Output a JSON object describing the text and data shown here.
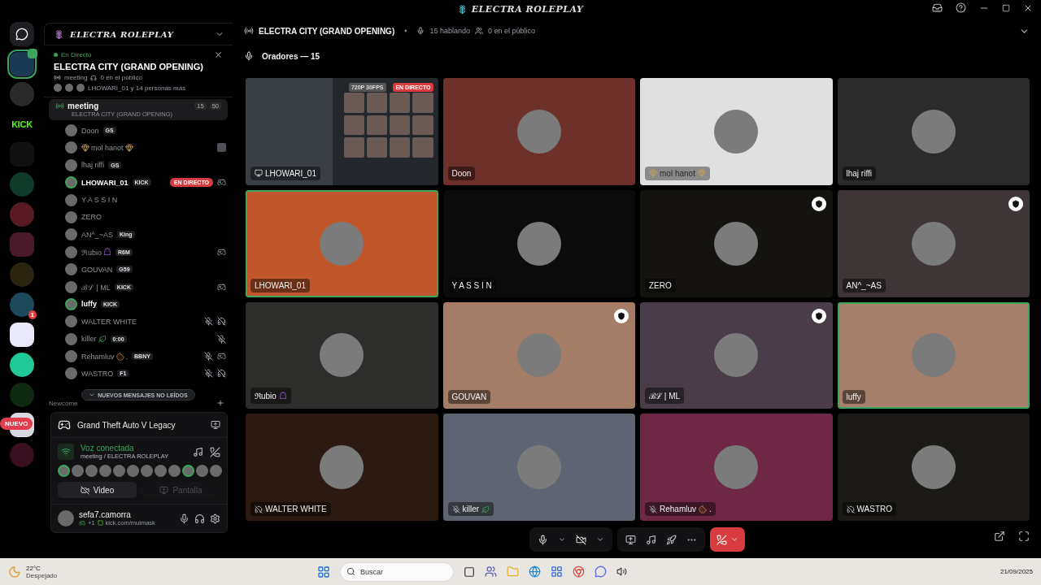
{
  "window": {
    "title": "ELECTRA ROLEPLAY"
  },
  "server_rail": [
    {
      "kind": "home"
    },
    {
      "kind": "server",
      "color": "#1b3a55",
      "unread": true
    },
    {
      "kind": "server",
      "color": "#2a2a2a",
      "unread": false
    },
    {
      "kind": "logo",
      "label": "KICK"
    },
    {
      "kind": "server",
      "color": "#111111",
      "unread": false
    },
    {
      "kind": "server",
      "color": "#0e3b2a",
      "unread": false
    },
    {
      "kind": "server",
      "color": "#5a1a24",
      "unread": false
    },
    {
      "kind": "server",
      "color": "#4a1a2a",
      "unread": false
    },
    {
      "kind": "server",
      "color": "#2b2410",
      "unread": false
    },
    {
      "kind": "server",
      "color": "#1d4a5a",
      "unread": false,
      "badge": "1"
    },
    {
      "kind": "server",
      "color": "#e8e8f8",
      "unread": false
    },
    {
      "kind": "server",
      "color": "#20c997",
      "unread": false
    },
    {
      "kind": "server",
      "color": "#102a12",
      "unread": false
    },
    {
      "kind": "server",
      "color": "#d8d8e0",
      "unread": false,
      "pill": "NUEVO"
    },
    {
      "kind": "server",
      "color": "#3a1020",
      "unread": false
    }
  ],
  "sidebar": {
    "server_name": "ELECTRA ROLEPLAY",
    "live_card": {
      "status": "En Directo",
      "title": "ELECTRA CITY (GRAND OPENING)",
      "channel": "meeting",
      "audience": "0 en el público",
      "participants": "LHOWARI_01 y 14 personas más"
    },
    "channel": {
      "name": "meeting",
      "topic": "ELECTRA CITY (GRAND OPENING)",
      "count": "15",
      "limit": "50"
    },
    "members": [
      {
        "name": "Doon",
        "tag": "GS",
        "speaking": false,
        "live": false
      },
      {
        "name": "mol hanot",
        "emoji": {
          "kind": "trident"
        },
        "speaking": false,
        "live": false,
        "icons": [
          {
            "kind": "app"
          }
        ]
      },
      {
        "name": "lhaj riffi",
        "tag": "GS",
        "speaking": false,
        "live": false
      },
      {
        "name": "LHOWARI_01",
        "tag": "KICK",
        "speaking": true,
        "live": true,
        "live_label": "EN DIRECTO",
        "icons": [
          {
            "kind": "game"
          }
        ]
      },
      {
        "name": "Y A S S I N",
        "speaking": false,
        "live": false
      },
      {
        "name": "ZERO",
        "speaking": false,
        "live": false
      },
      {
        "name": "AN^_~AS",
        "tag": "King",
        "speaking": false,
        "live": false
      },
      {
        "name": "ℜubio",
        "emoji": {
          "kind": "alien"
        },
        "tag": "R6M",
        "speaking": false,
        "live": false,
        "icons": [
          {
            "kind": "game"
          }
        ]
      },
      {
        "name": "GOUVAN",
        "tag": "G59",
        "speaking": false,
        "live": false
      },
      {
        "name": "ℬℒ | ML",
        "tag": "KICK",
        "speaking": false,
        "live": false,
        "icons": [
          {
            "kind": "game"
          }
        ]
      },
      {
        "name": "luffy",
        "tag": "KICK",
        "speaking": true,
        "live": false
      },
      {
        "name": "WALTER WHITE",
        "speaking": false,
        "live": false,
        "icons": [
          {
            "kind": "muted"
          },
          {
            "kind": "deafened"
          }
        ]
      },
      {
        "name": "killer",
        "emoji": {
          "kind": "leaf"
        },
        "tag": "0:00",
        "speaking": false,
        "live": false,
        "icons": [
          {
            "kind": "muted"
          }
        ]
      },
      {
        "name": "Rehamluv",
        "emoji": {
          "kind": "cookie"
        },
        "name_end": ".",
        "tag": "BBNY",
        "speaking": false,
        "live": false,
        "icons": [
          {
            "kind": "muted"
          },
          {
            "kind": "game"
          }
        ]
      },
      {
        "name": "WASTRO",
        "tag": "F1",
        "speaking": false,
        "live": false,
        "icons": [
          {
            "kind": "muted"
          },
          {
            "kind": "deafened"
          }
        ]
      }
    ],
    "unread_pill": "NUEVOS MENSAJES NO LEÍDOS",
    "next_category": "Newcome",
    "activity": {
      "game": "Grand Theft Auto V Legacy"
    },
    "voice": {
      "status": "Voz conectada",
      "location": "meeting / ELECTRA ROLEPLAY",
      "avatars": [
        {
          "speaking": true
        },
        {
          "speaking": false
        },
        {
          "speaking": false
        },
        {
          "speaking": false
        },
        {
          "speaking": false
        },
        {
          "speaking": false
        },
        {
          "speaking": false
        },
        {
          "speaking": false
        },
        {
          "speaking": false
        },
        {
          "speaking": true
        },
        {
          "speaking": false
        },
        {
          "speaking": false
        }
      ],
      "buttons": [
        {
          "label": "Video",
          "disabled": false
        },
        {
          "label": "Pantalla",
          "disabled": true
        }
      ]
    },
    "user": {
      "name": "sefa7.camorra",
      "activity_count": "+1",
      "status": "kick.com/mulmask"
    }
  },
  "stage": {
    "title": "ELECTRA CITY (GRAND OPENING)",
    "separator": "•",
    "speaking": "15 hablando",
    "audience": "0 en el público",
    "speakers_label": "Oradores — 15",
    "tiles": [
      {
        "kind": "stream",
        "name": "LHOWARI_01",
        "color": "#2a2d33",
        "speaking": false,
        "badge": false,
        "status": {
          "kind": "screen"
        },
        "quality": "720P 30FPS",
        "live_label": "EN DIRECTO"
      },
      {
        "kind": "user",
        "name": "Doon",
        "color": "#6e302a",
        "speaking": false,
        "badge": false
      },
      {
        "kind": "user",
        "name": "mol hanot",
        "emoji": {
          "kind": "trident"
        },
        "color": "#e0e0e0",
        "speaking": false,
        "badge": false
      },
      {
        "kind": "user",
        "name": "lhaj riffi",
        "color": "#2b2b2b",
        "speaking": false,
        "badge": false
      },
      {
        "kind": "user",
        "name": "LHOWARI_01",
        "color": "#c0562a",
        "speaking": true,
        "badge": false
      },
      {
        "kind": "user",
        "name": "Y A S S I N",
        "color": "#0b0b0b",
        "speaking": false,
        "badge": false
      },
      {
        "kind": "user",
        "name": "ZERO",
        "color": "#15130f",
        "speaking": false,
        "badge": true
      },
      {
        "kind": "user",
        "name": "AN^_~AS",
        "color": "#3e3536",
        "speaking": false,
        "badge": true
      },
      {
        "kind": "user",
        "name": "ℜubio",
        "emoji": {
          "kind": "alien"
        },
        "color": "#2d2d2b",
        "speaking": false,
        "badge": false
      },
      {
        "kind": "user",
        "name": "GOUVAN",
        "color": "#a57d66",
        "speaking": false,
        "badge": true
      },
      {
        "kind": "user",
        "name": "ℬℒ | ML",
        "color": "#4a3d49",
        "speaking": false,
        "badge": true
      },
      {
        "kind": "user",
        "name": "luffy",
        "color": "#a57f6a",
        "speaking": true,
        "badge": false
      },
      {
        "kind": "user",
        "name": "WALTER WHITE",
        "color": "#2a1a12",
        "speaking": false,
        "badge": false,
        "status": {
          "kind": "deafened"
        }
      },
      {
        "kind": "user",
        "name": "killer",
        "emoji": {
          "kind": "leaf"
        },
        "color": "#5f6472",
        "speaking": false,
        "badge": false,
        "status": {
          "kind": "muted"
        }
      },
      {
        "kind": "user",
        "name": "Rehamluv",
        "emoji": {
          "kind": "cookie"
        },
        "name_end": ".",
        "color": "#6e2846",
        "speaking": false,
        "badge": false,
        "status": {
          "kind": "muted"
        }
      },
      {
        "kind": "user",
        "name": "WASTRO",
        "color": "#1c1a16",
        "speaking": false,
        "badge": false,
        "status": {
          "kind": "deafened"
        }
      }
    ]
  },
  "taskbar": {
    "temperature": "22°C",
    "weather": "Despejado",
    "search_placeholder": "Buscar",
    "date": "21/09/2025"
  }
}
